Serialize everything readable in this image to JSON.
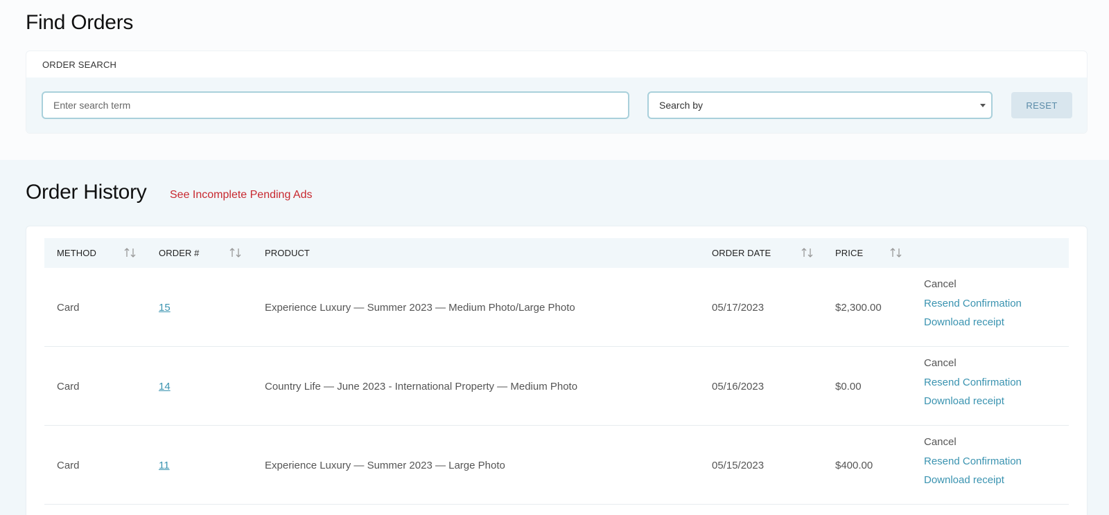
{
  "find_orders": {
    "title": "Find Orders",
    "card_title": "ORDER SEARCH",
    "search_placeholder": "Enter search term",
    "search_value": "",
    "search_by_label": "Search by",
    "reset_label": "RESET"
  },
  "order_history": {
    "title": "Order History",
    "pending_link": "See Incomplete Pending Ads",
    "columns": {
      "method": "METHOD",
      "order_no": "ORDER #",
      "product": "PRODUCT",
      "order_date": "ORDER DATE",
      "price": "PRICE"
    },
    "rows": [
      {
        "method": "Card",
        "order_no": "15",
        "product": "Experience Luxury — Summer 2023 — Medium Photo/Large Photo",
        "order_date": "05/17/2023",
        "price": "$2,300.00",
        "actions": [
          "Cancel",
          "Resend Confirmation",
          "Download receipt"
        ]
      },
      {
        "method": "Card",
        "order_no": "14",
        "product": "Country Life — June 2023 - International Property — Medium Photo",
        "order_date": "05/16/2023",
        "price": "$0.00",
        "actions": [
          "Cancel",
          "Resend Confirmation",
          "Download receipt"
        ]
      },
      {
        "method": "Card",
        "order_no": "11",
        "product": "Experience Luxury — Summer 2023 — Large Photo",
        "order_date": "05/15/2023",
        "price": "$400.00",
        "actions": [
          "Cancel",
          "Resend Confirmation",
          "Download receipt"
        ]
      }
    ]
  },
  "icons": {
    "sort": "sort-arrows-icon",
    "dropdown": "chevron-down-icon"
  },
  "colors": {
    "link": "#3a93b0",
    "pending_link": "#c8282f",
    "section_bg": "#f1f7fa",
    "input_border": "#a9d0db",
    "reset_bg": "#d9e6ee"
  }
}
